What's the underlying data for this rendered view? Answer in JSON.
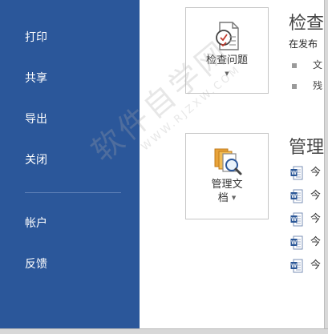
{
  "nav": {
    "items": [
      "打印",
      "共享",
      "导出",
      "关闭"
    ],
    "items_lower": [
      "帐户",
      "反馈"
    ]
  },
  "inspect": {
    "tile_label": "检查问题",
    "title": "检查",
    "desc": "在发布",
    "bullets": [
      "文",
      "残"
    ]
  },
  "manage": {
    "tile_label_line1": "管理文",
    "tile_label_line2": "档",
    "title": "管理",
    "docs": [
      "今",
      "今",
      "今",
      "今",
      "今"
    ]
  },
  "watermark": {
    "main": "软件自学网",
    "sub": "WWW.RJZXW.COM"
  },
  "colors": {
    "nav_bg": "#2b579a",
    "word_blue": "#2b5797"
  },
  "icons": {
    "inspect": "inspect-document-icon",
    "manage": "manage-versions-icon",
    "doc": "word-document-icon"
  }
}
